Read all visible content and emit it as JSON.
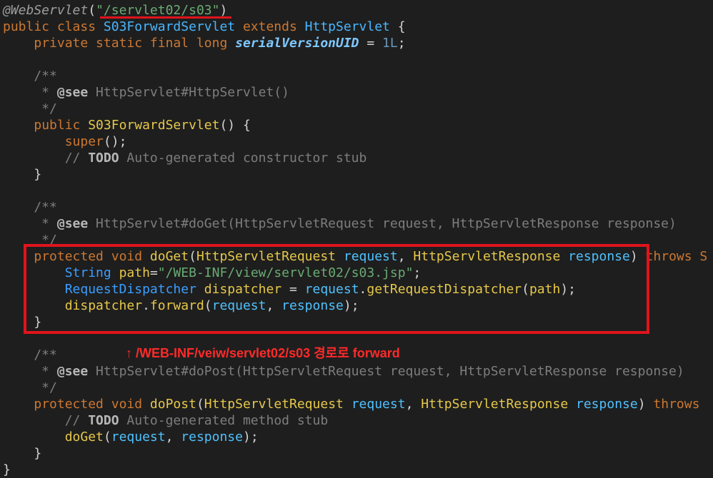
{
  "code": {
    "l1": {
      "annotation": "@WebServlet",
      "paren_open": "(",
      "path": "\"/servlet02/s03\"",
      "paren_close": ")"
    },
    "l2": {
      "kw": "public class ",
      "cls": "S03ForwardServlet",
      "ext": " extends ",
      "parent": "HttpServlet",
      "brace": " {"
    },
    "l3": {
      "indent": "    ",
      "kw": "private static final long ",
      "field": "serialVersionUID",
      "eq": " = ",
      "num": "1L",
      "semi": ";"
    },
    "l5": "    /**",
    "l6": {
      "pre": "     * ",
      "tag": "@see",
      "rest": " HttpServlet#HttpServlet()"
    },
    "l7": "     */",
    "l8": {
      "indent": "    ",
      "kw": "public ",
      "fn": "S03ForwardServlet",
      "rest": "() {"
    },
    "l9": {
      "indent": "        ",
      "fn": "super",
      "rest": "();"
    },
    "l10": {
      "pre": "        // ",
      "todo": "TODO",
      "rest": " Auto-generated constructor stub"
    },
    "l11": "    }",
    "l13": "    /**",
    "l14": {
      "pre": "     * ",
      "tag": "@see",
      "rest": " HttpServlet#doGet(HttpServletRequest request, HttpServletResponse response)"
    },
    "l15": "     */",
    "l16": {
      "indent": "    ",
      "kw": "protected void ",
      "fn": "doGet",
      "p1": "(",
      "t1": "HttpServletRequest",
      "v1": " request",
      "c": ", ",
      "t2": "HttpServletResponse",
      "v2": " response",
      "p2": ") ",
      "throws": "throws S"
    },
    "l17": {
      "indent": "        ",
      "ty": "String",
      "sp": " ",
      "var": "path",
      "eq": "=",
      "str": "\"/WEB-INF/view/servlet02/s03.jsp\"",
      "semi": ";"
    },
    "l18": {
      "indent": "        ",
      "ty": "RequestDispatcher",
      "sp": " ",
      "var": "dispatcher",
      "eq": " = ",
      "obj": "request",
      "dot": ".",
      "fn": "getRequestDispatcher",
      "p1": "(",
      "arg": "path",
      "p2": ");"
    },
    "l19": {
      "indent": "        ",
      "obj": "dispatcher",
      "dot": ".",
      "fn": "forward",
      "p1": "(",
      "a1": "request",
      "c": ", ",
      "a2": "response",
      "p2": ");"
    },
    "l20": "    }",
    "l22": "    /**",
    "l23": {
      "pre": "     * ",
      "tag": "@see",
      "rest": " HttpServlet#doPost(HttpServletRequest request, HttpServletResponse response)"
    },
    "l24": "     */",
    "l25": {
      "indent": "    ",
      "kw": "protected void ",
      "fn": "doPost",
      "p1": "(",
      "t1": "HttpServletRequest",
      "v1": " request",
      "c": ", ",
      "t2": "HttpServletResponse",
      "v2": " response",
      "p2": ") ",
      "throws": "throws"
    },
    "l26": {
      "pre": "        // ",
      "todo": "TODO",
      "rest": " Auto-generated method stub"
    },
    "l27": {
      "indent": "        ",
      "fn": "doGet",
      "p1": "(",
      "a1": "request",
      "c": ", ",
      "a2": "response",
      "p2": ");"
    },
    "l28": "    }",
    "l29": "}"
  },
  "annotation_note": "↑ /WEB-INF/veiw/servlet02/s03 경로로 forward",
  "colors": {
    "highlight": "#e0141c",
    "background": "#1e1e1e"
  }
}
